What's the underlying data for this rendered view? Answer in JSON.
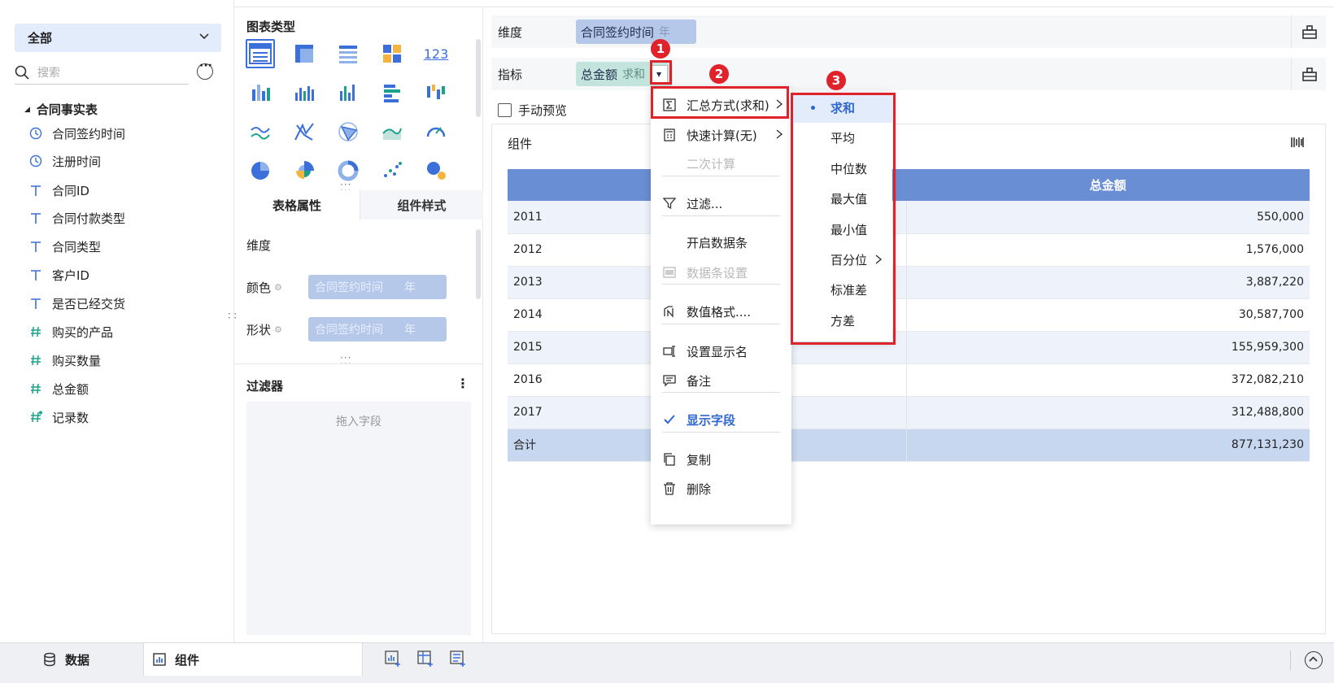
{
  "left": {
    "scope": "全部",
    "search_placeholder": "搜索",
    "table_name": "合同事实表",
    "fields": [
      {
        "label": "合同签约时间",
        "kind": "clock"
      },
      {
        "label": "注册时间",
        "kind": "clock"
      },
      {
        "label": "合同ID",
        "kind": "T"
      },
      {
        "label": "合同付款类型",
        "kind": "T"
      },
      {
        "label": "合同类型",
        "kind": "T"
      },
      {
        "label": "客户ID",
        "kind": "T"
      },
      {
        "label": "是否已经交货",
        "kind": "T"
      },
      {
        "label": "购买的产品",
        "kind": "#"
      },
      {
        "label": "购买数量",
        "kind": "#"
      },
      {
        "label": "总金额",
        "kind": "#"
      },
      {
        "label": "记录数",
        "kind": "#*"
      }
    ]
  },
  "middle": {
    "chart_type_title": "图表类型",
    "tabs": [
      "表格属性",
      "组件样式"
    ],
    "dimension_label": "维度",
    "color_label": "颜色",
    "shape_label": "形状",
    "pill_field": "合同签约时间",
    "pill_granularity": "年",
    "filter_title": "过滤器",
    "filter_placeholder": "拖入字段"
  },
  "shelves": {
    "dimension_label": "维度",
    "dimension_pill": "合同签约时间",
    "dimension_pill_sub": "年",
    "measure_label": "指标",
    "measure_pill": "总金额",
    "measure_pill_sub": "求和"
  },
  "manual_preview": "手动预览",
  "widget": {
    "title": "组件",
    "header": [
      "",
      "总金额"
    ],
    "rows": [
      {
        "year": "2011",
        "value": "550,000"
      },
      {
        "year": "2012",
        "value": "1,576,000"
      },
      {
        "year": "2013",
        "value": "3,887,220"
      },
      {
        "year": "2014",
        "value": "30,587,700"
      },
      {
        "year": "2015",
        "value": "155,959,300"
      },
      {
        "year": "2016",
        "value": "372,082,210"
      },
      {
        "year": "2017",
        "value": "312,488,800"
      }
    ],
    "total_label": "合计",
    "total_value": "877,131,230"
  },
  "context_menu": {
    "items": [
      {
        "label": "汇总方式(求和)",
        "icon": "sigma-icon",
        "arrow": true,
        "state": "normal"
      },
      {
        "label": "快速计算(无)",
        "icon": "calculator-icon",
        "arrow": true,
        "state": "normal"
      },
      {
        "label": "二次计算",
        "icon": "",
        "arrow": false,
        "state": "disabled"
      },
      {
        "label": "过滤...",
        "icon": "funnel-icon",
        "arrow": false,
        "state": "normal"
      },
      {
        "label": "开启数据条",
        "icon": "",
        "arrow": false,
        "state": "normal"
      },
      {
        "label": "数据条设置",
        "icon": "databar-icon",
        "arrow": false,
        "state": "disabled"
      },
      {
        "label": "数值格式....",
        "icon": "number-format-icon",
        "arrow": false,
        "state": "normal"
      },
      {
        "label": "设置显示名",
        "icon": "rename-icon",
        "arrow": false,
        "state": "normal"
      },
      {
        "label": "备注",
        "icon": "comment-icon",
        "arrow": false,
        "state": "normal"
      },
      {
        "label": "显示字段",
        "icon": "check-icon",
        "arrow": false,
        "state": "accent"
      },
      {
        "label": "复制",
        "icon": "copy-icon",
        "arrow": false,
        "state": "normal"
      },
      {
        "label": "删除",
        "icon": "trash-icon",
        "arrow": false,
        "state": "normal"
      }
    ]
  },
  "aggregation_menu": {
    "items": [
      "求和",
      "平均",
      "中位数",
      "最大值",
      "最小值",
      "百分位",
      "标准差",
      "方差"
    ],
    "selected": "求和"
  },
  "annotations": [
    "1",
    "2",
    "3"
  ],
  "bottom": {
    "data_tab": "数据",
    "widget_tab": "组件"
  },
  "colors": {
    "accent": "#2f66d0",
    "table_header": "#6a8ed4",
    "annotation_red": "#e0232a",
    "dimension_pill": "#b6c8ea",
    "measure_pill": "#c3e4dc"
  }
}
